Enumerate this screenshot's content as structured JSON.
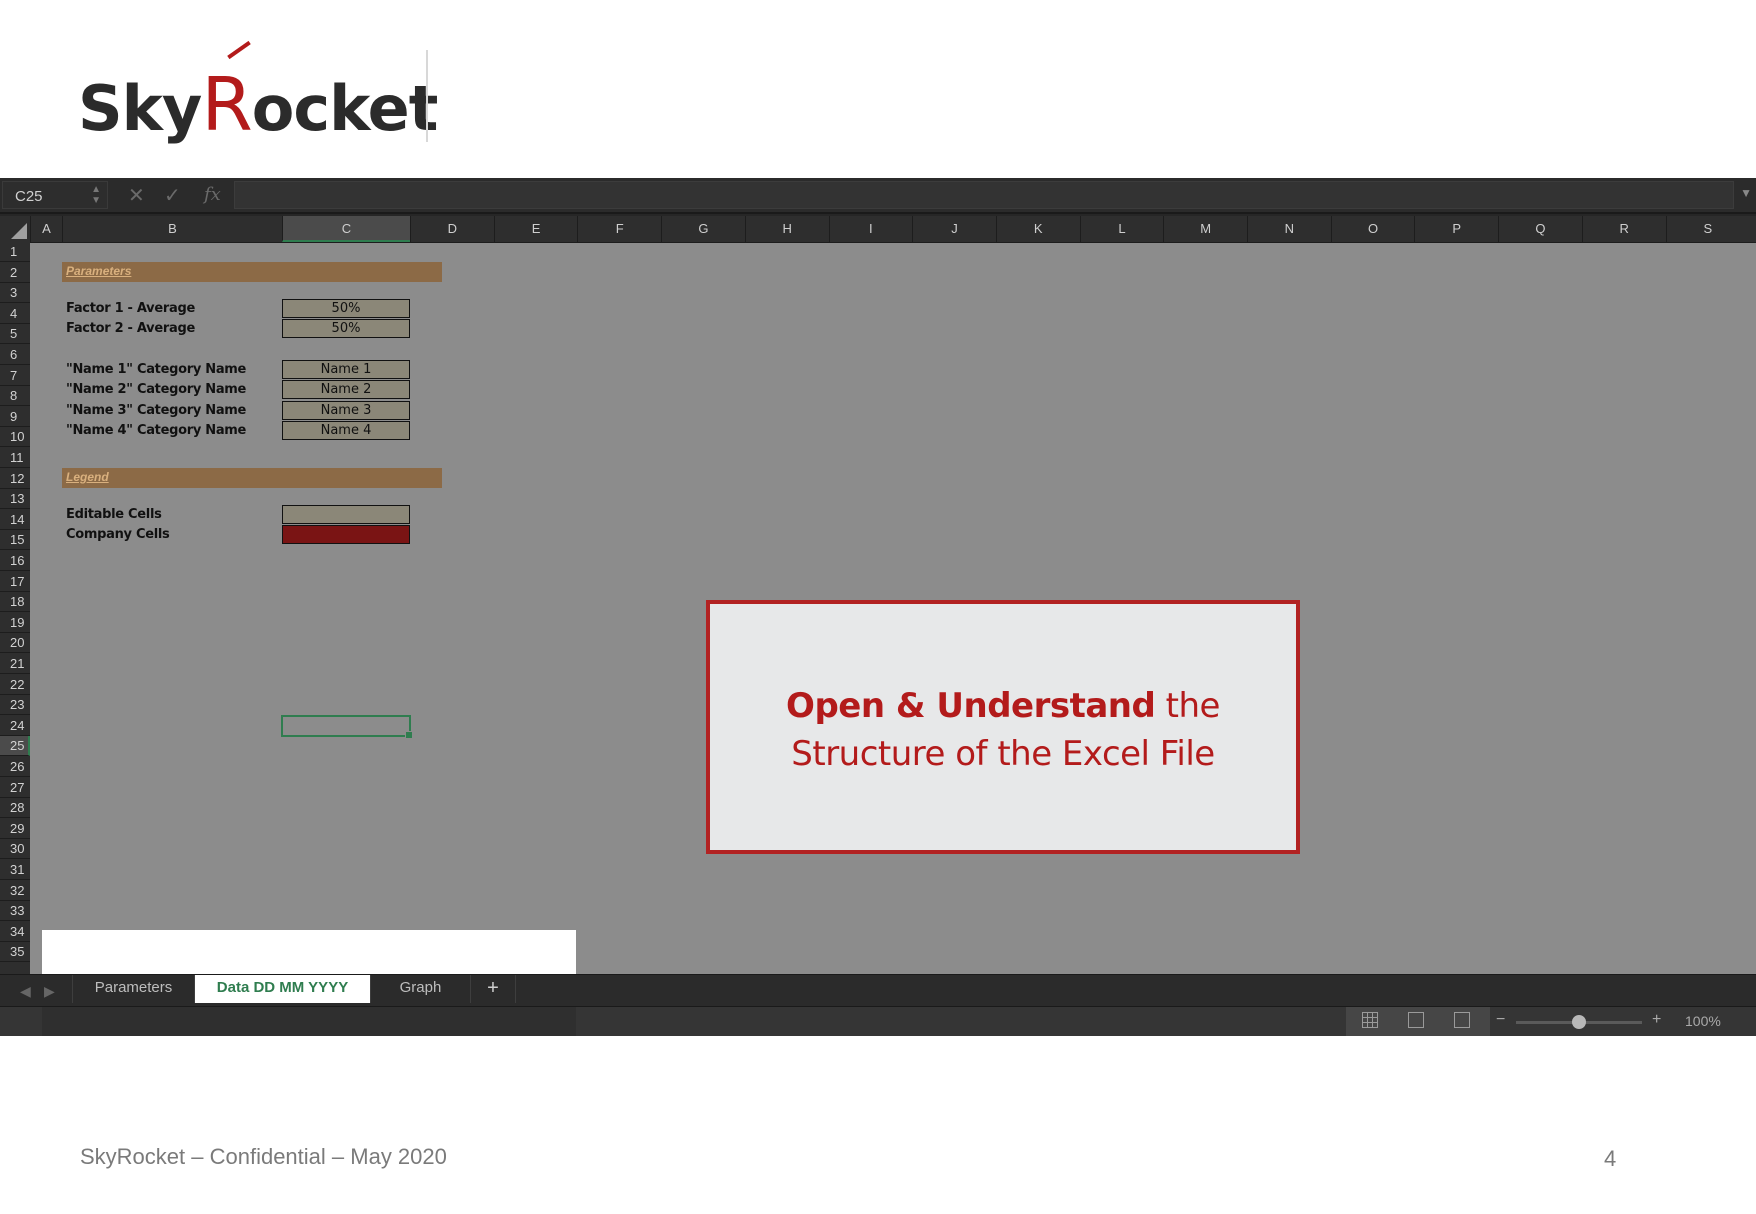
{
  "logo": {
    "part1": "Sky",
    "part2": "R",
    "part3": "ocket"
  },
  "excel": {
    "name_box": "C25",
    "columns": [
      "A",
      "B",
      "C",
      "D",
      "E",
      "F",
      "G",
      "H",
      "I",
      "J",
      "K",
      "L",
      "M",
      "N",
      "O",
      "P",
      "Q",
      "R",
      "S"
    ],
    "rows": [
      "1",
      "2",
      "3",
      "4",
      "5",
      "6",
      "7",
      "8",
      "9",
      "10",
      "11",
      "12",
      "13",
      "14",
      "15",
      "16",
      "17",
      "18",
      "19",
      "20",
      "21",
      "22",
      "23",
      "24",
      "25",
      "26",
      "27",
      "28",
      "29",
      "30",
      "31",
      "32",
      "33",
      "34",
      "35"
    ],
    "active_cell": {
      "column": "C",
      "row": "25"
    },
    "parameters_header": "Parameters",
    "parameters": [
      {
        "label": "Factor 1 - Average",
        "value": "50%"
      },
      {
        "label": "Factor 2 - Average",
        "value": "50%"
      },
      {
        "label": "\"Name 1\" Category Name",
        "value": "Name 1"
      },
      {
        "label": "\"Name 2\" Category Name",
        "value": "Name 2"
      },
      {
        "label": "\"Name 3\" Category Name",
        "value": "Name 3"
      },
      {
        "label": "\"Name 4\" Category Name",
        "value": "Name 4"
      }
    ],
    "legend_header": "Legend",
    "legend": [
      {
        "label": "Editable Cells",
        "color": "#8b8778"
      },
      {
        "label": "Company Cells",
        "color": "#7a1414"
      }
    ],
    "callout": {
      "bold": "Open & Understand",
      "rest_line1": " the",
      "line2": "Structure of the Excel File"
    },
    "sheet_tabs": [
      {
        "label": "Parameters",
        "active": false
      },
      {
        "label": "Data DD MM YYYY",
        "active": true
      },
      {
        "label": "Graph",
        "active": false
      }
    ],
    "add_sheet": "+",
    "zoom": "100%",
    "zoom_minus": "−",
    "zoom_plus": "+"
  },
  "footer": {
    "text": "SkyRocket – Confidential – May 2020",
    "page": "4"
  },
  "colors": {
    "accent_red": "#b31b1b",
    "excel_green": "#2f7d4f",
    "grid_bg": "#8c8c8c"
  }
}
